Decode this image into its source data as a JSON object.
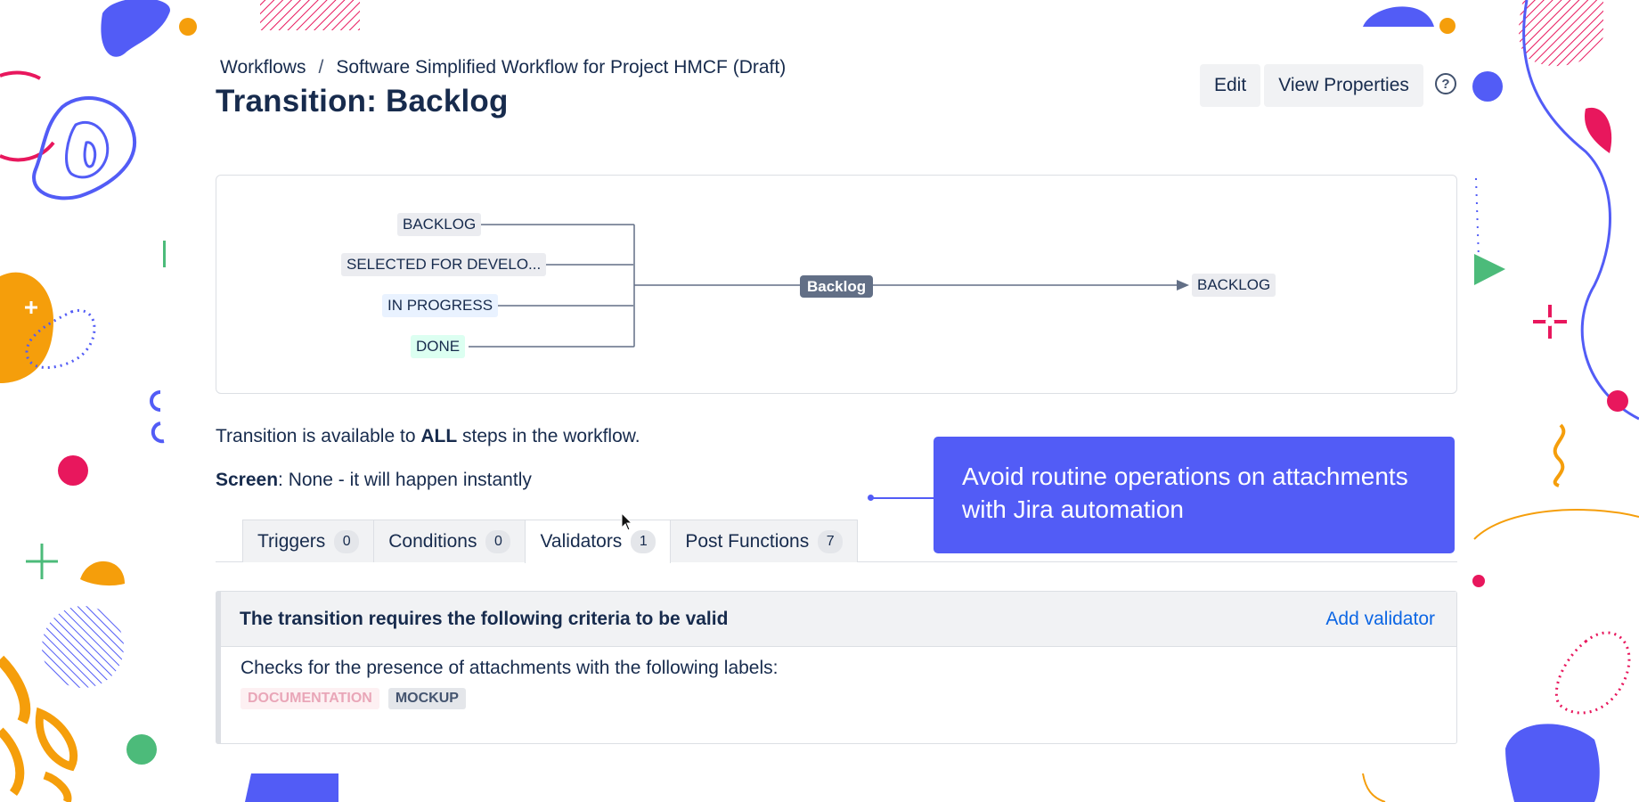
{
  "breadcrumb": {
    "items": [
      "Workflows",
      "Software Simplified Workflow for Project HMCF (Draft)"
    ],
    "separator": "/"
  },
  "page": {
    "title": "Transition: Backlog"
  },
  "actions": {
    "edit_label": "Edit",
    "view_properties_label": "View Properties",
    "help_icon": "?"
  },
  "diagram": {
    "from_statuses": [
      "BACKLOG",
      "SELECTED FOR DEVELO...",
      "IN PROGRESS",
      "DONE"
    ],
    "transition": "Backlog",
    "to_status": "BACKLOG"
  },
  "info": {
    "availability_prefix": "Transition is available to ",
    "availability_bold": "ALL",
    "availability_suffix": " steps in the workflow.",
    "screen_label": "Screen",
    "screen_value": ": None - it will happen instantly"
  },
  "tabs": [
    {
      "label": "Triggers",
      "count": "0",
      "active": false
    },
    {
      "label": "Conditions",
      "count": "0",
      "active": false
    },
    {
      "label": "Validators",
      "count": "1",
      "active": true
    },
    {
      "label": "Post Functions",
      "count": "7",
      "active": false
    }
  ],
  "validator_panel": {
    "title": "The transition requires the following criteria to be valid",
    "add_link": "Add validator",
    "description": "Checks for the presence of attachments with the following labels:",
    "labels": [
      "DOCUMENTATION",
      "MOCKUP"
    ]
  },
  "callout": {
    "text": "Avoid routine operations on attachments with Jira automation"
  },
  "colors": {
    "accent": "#525cf6",
    "link": "#0c66e4",
    "text": "#172b4d"
  }
}
